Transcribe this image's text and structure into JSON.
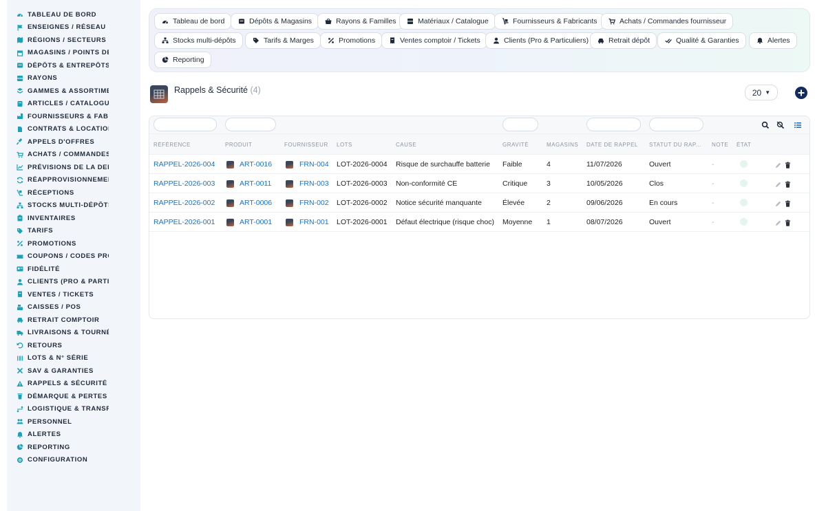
{
  "sidebar": {
    "items": [
      {
        "label": "TABLEAU DE BORD",
        "icon": "gauge-icon"
      },
      {
        "label": "ENSEIGNES / RÉSEAU",
        "icon": "flag-icon"
      },
      {
        "label": "RÉGIONS / SECTEURS",
        "icon": "map-icon"
      },
      {
        "label": "MAGASINS / POINTS DE V",
        "icon": "store-icon"
      },
      {
        "label": "DÉPÔTS & ENTREPÔTS",
        "icon": "warehouse-icon"
      },
      {
        "label": "RAYONS",
        "icon": "shelf-icon"
      },
      {
        "label": "GAMMES & ASSORTIMEN",
        "icon": "layers-icon"
      },
      {
        "label": "ARTICLES / CATALOGUE",
        "icon": "box-icon"
      },
      {
        "label": "FOURNISSEURS & FABRI",
        "icon": "factory-icon"
      },
      {
        "label": "CONTRATS & LOCATION",
        "icon": "contract-icon"
      },
      {
        "label": "APPELS D'OFFRES",
        "icon": "gavel-icon"
      },
      {
        "label": "ACHATS / COMMANDES F",
        "icon": "cart-icon"
      },
      {
        "label": "PRÉVISIONS DE LA DEMA",
        "icon": "trend-icon"
      },
      {
        "label": "RÉAPPROVISIONNEMENT",
        "icon": "refresh-icon"
      },
      {
        "label": "RÉCEPTIONS",
        "icon": "truck-ramp-icon"
      },
      {
        "label": "STOCKS MULTI-DÉPÔTS",
        "icon": "sitemap-icon"
      },
      {
        "label": "INVENTAIRES",
        "icon": "clipboard-icon"
      },
      {
        "label": "TARIFS",
        "icon": "tag-icon"
      },
      {
        "label": "PROMOTIONS",
        "icon": "percent-icon"
      },
      {
        "label": "COUPONS / CODES PROM",
        "icon": "ticket-icon"
      },
      {
        "label": "FIDÉLITÉ",
        "icon": "card-icon"
      },
      {
        "label": "CLIENTS (PRO & PARTICU",
        "icon": "user-icon"
      },
      {
        "label": "VENTES / TICKETS",
        "icon": "receipt-icon"
      },
      {
        "label": "CAISSES / POS",
        "icon": "cash-register-icon"
      },
      {
        "label": "RETRAIT COMPTOIR",
        "icon": "car-icon"
      },
      {
        "label": "LIVRAISONS & TOURNÉE:",
        "icon": "delivery-truck-icon"
      },
      {
        "label": "RETOURS",
        "icon": "undo-icon"
      },
      {
        "label": "LOTS & N° SÉRIE",
        "icon": "barcode-icon"
      },
      {
        "label": "SAV & GARANTIES",
        "icon": "tools-icon"
      },
      {
        "label": "RAPPELS & SÉCURITÉ",
        "icon": "warning-icon"
      },
      {
        "label": "DÉMARQUE & PERTES",
        "icon": "trash-icon"
      },
      {
        "label": "LOGISTIQUE & TRANSPO",
        "icon": "route-icon"
      },
      {
        "label": "PERSONNEL",
        "icon": "users-icon"
      },
      {
        "label": "ALERTES",
        "icon": "bell-icon"
      },
      {
        "label": "REPORTING",
        "icon": "chart-pie-icon"
      },
      {
        "label": "CONFIGURATION",
        "icon": "cog-icon"
      }
    ]
  },
  "nav": {
    "buttons": [
      {
        "label": "Tableau de bord",
        "icon": "gauge-icon"
      },
      {
        "label": "Dépôts & Magasins",
        "icon": "warehouse-icon"
      },
      {
        "label": "Rayons & Familles",
        "icon": "basket-icon"
      },
      {
        "label": "Matériaux / Catalogue",
        "icon": "grid-icon"
      },
      {
        "label": "Fournisseurs & Fabricants",
        "icon": "dolly-icon"
      },
      {
        "label": "Achats / Commandes fournisseur",
        "icon": "cart-icon"
      },
      {
        "label": "Stocks multi-dépôts",
        "icon": "sitemap-icon"
      },
      {
        "label": "Tarifs & Marges",
        "icon": "tags-icon"
      },
      {
        "label": "Promotions",
        "icon": "percent-icon"
      },
      {
        "label": "Ventes comptoir / Tickets",
        "icon": "receipt-icon"
      },
      {
        "label": "Clients (Pro & Particuliers)",
        "icon": "user-icon"
      },
      {
        "label": "Retrait dépôt",
        "icon": "car-icon"
      },
      {
        "label": "Qualité & Garanties",
        "icon": "check-double-icon"
      },
      {
        "label": "Alertes",
        "icon": "bell-icon"
      },
      {
        "label": "Reporting",
        "icon": "chart-pie-icon"
      }
    ]
  },
  "page": {
    "title": "Rappels & Sécurité",
    "count": "(4)",
    "page_size": "20"
  },
  "table": {
    "headers": [
      "RÉFÉRENCE",
      "PRODUIT",
      "FOURNISSEUR",
      "LOTS",
      "CAUSE",
      "GRAVITÉ",
      "MAGASINS",
      "DATE DE RAPPEL",
      "STATUT DU RAP...",
      "NOTE",
      "ÉTAT"
    ],
    "rows": [
      {
        "ref": "RAPPEL-2026-004",
        "produit": "ART-0016",
        "fournisseur": "FRN-004",
        "lots": "LOT-2026-0004",
        "cause": "Risque de surchauffe batterie",
        "gravite": "Faible",
        "magasins": "4",
        "date": "11/07/2026",
        "statut": "Ouvert",
        "note": "-"
      },
      {
        "ref": "RAPPEL-2026-003",
        "produit": "ART-0011",
        "fournisseur": "FRN-003",
        "lots": "LOT-2026-0003",
        "cause": "Non-conformité CE",
        "gravite": "Critique",
        "magasins": "3",
        "date": "10/05/2026",
        "statut": "Clos",
        "note": "-"
      },
      {
        "ref": "RAPPEL-2026-002",
        "produit": "ART-0006",
        "fournisseur": "FRN-002",
        "lots": "LOT-2026-0002",
        "cause": "Notice sécurité manquante",
        "gravite": "Élevée",
        "magasins": "2",
        "date": "09/06/2026",
        "statut": "En cours",
        "note": "-"
      },
      {
        "ref": "RAPPEL-2026-001",
        "produit": "ART-0001",
        "fournisseur": "FRN-001",
        "lots": "LOT-2026-0001",
        "cause": "Défaut électrique (risque choc)",
        "gravite": "Moyenne",
        "magasins": "1",
        "date": "08/07/2026",
        "statut": "Ouvert",
        "note": "-"
      }
    ]
  },
  "colors": {
    "link": "#1a73c9",
    "sidebar_bg": "#f2f5f9",
    "icon_teal": "#1aa3b8",
    "add_button": "#122a5c"
  }
}
